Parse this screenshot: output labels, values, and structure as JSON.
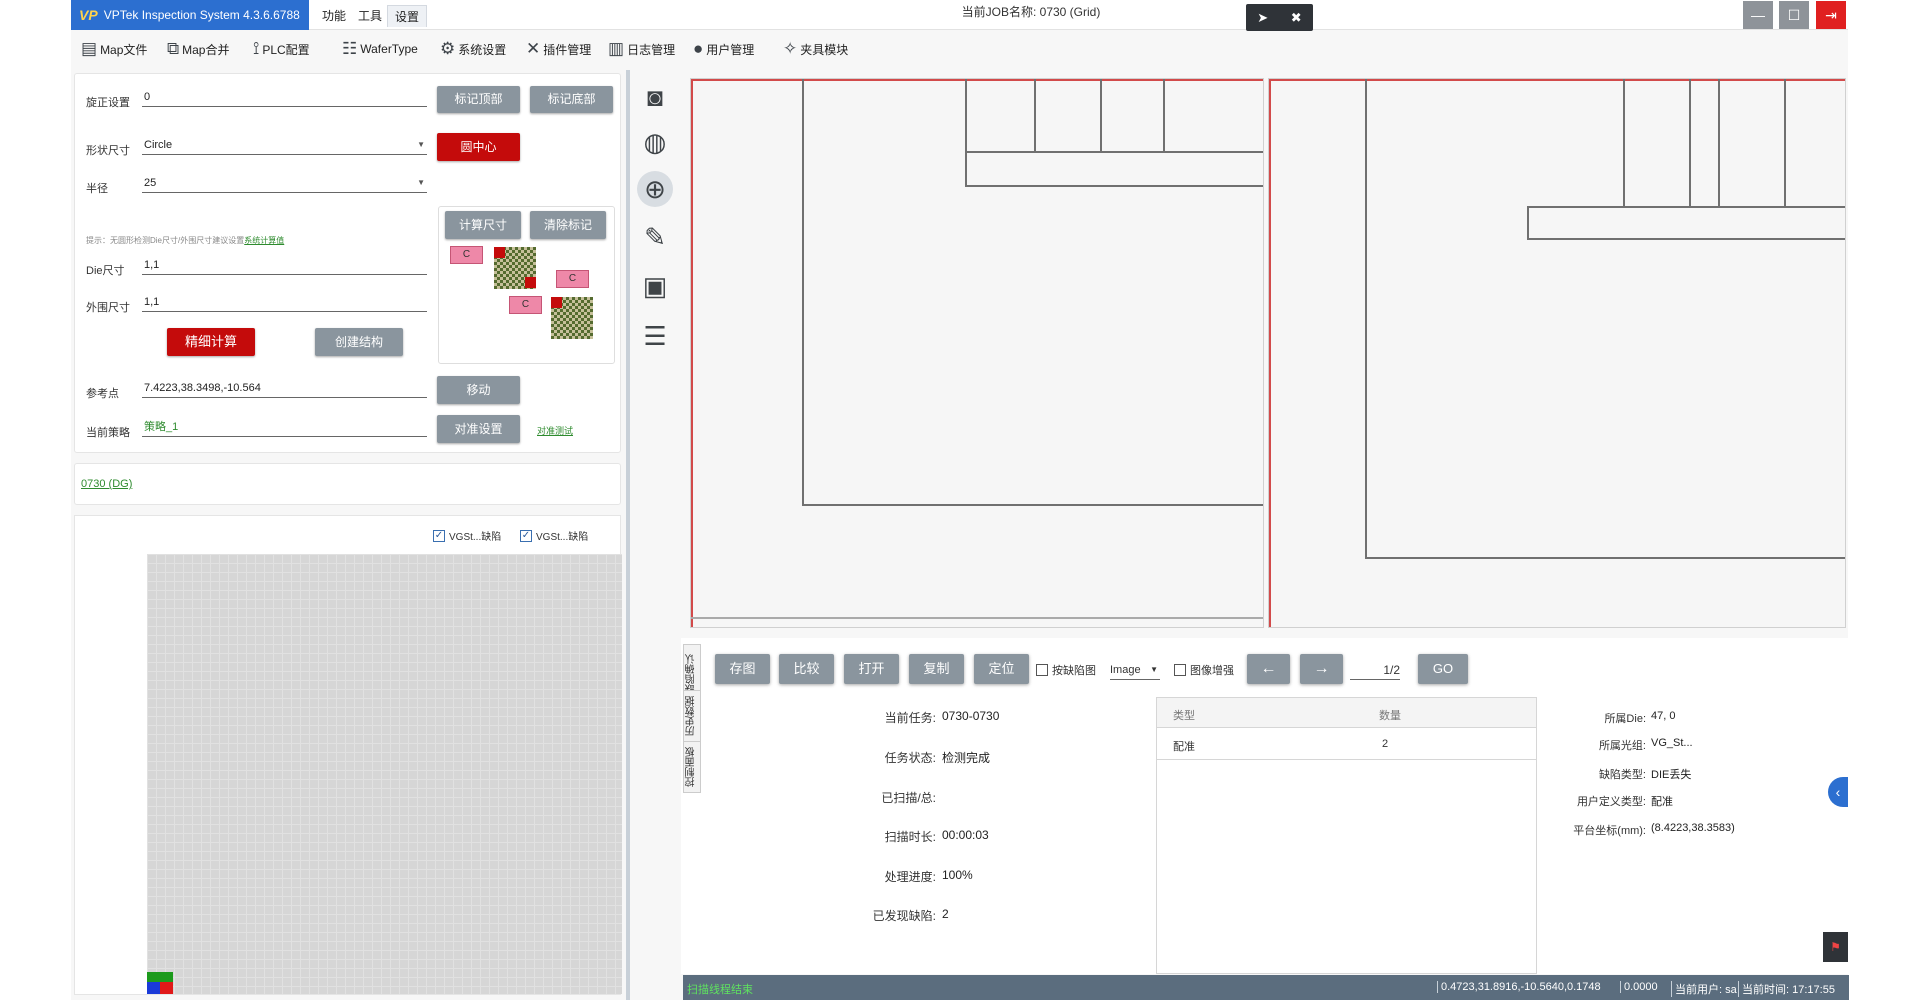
{
  "window": {
    "brand_logo": "VP",
    "app_title": "VPTek Inspection System 4.3.6.6788",
    "menus": [
      "功能",
      "工具",
      "设置"
    ],
    "active_menu": "设置",
    "job_title": "当前JOB名称: 0730 (Grid)"
  },
  "float_toolbar": {
    "cursor_icon": "cursor-icon",
    "close_icon": "close-circle-icon"
  },
  "window_controls": {
    "minimize": "—",
    "maximize": "☐",
    "exit": "⇥"
  },
  "toolbar": [
    {
      "label": "Map文件",
      "icon": "map-file-icon"
    },
    {
      "label": "Map合并",
      "icon": "map-merge-icon"
    },
    {
      "label": "PLC配置",
      "icon": "plc-icon"
    },
    {
      "label": "WaferType",
      "icon": "wafertype-icon"
    },
    {
      "label": "系统设置",
      "icon": "gear-icon"
    },
    {
      "label": "插件管理",
      "icon": "tools-icon"
    },
    {
      "label": "日志管理",
      "icon": "log-icon"
    },
    {
      "label": "用户管理",
      "icon": "user-icon"
    },
    {
      "label": "夹具模块",
      "icon": "fixture-icon"
    }
  ],
  "settings": {
    "rotation_label": "旋正设置",
    "rotation_value": "0",
    "mark_top_button": "标记顶部",
    "mark_bottom_button": "标记底部",
    "shape_label": "形状尺寸",
    "shape_value": "Circle",
    "circle_center_button": "圆中心",
    "radius_label": "半径",
    "radius_value": "25",
    "hint_text": "提示：无圆形检测Die尺寸/外围尺寸建议设置",
    "hint_link": "系统计算值",
    "die_size_label": "Die尺寸",
    "die_size_value": "1,1",
    "outer_size_label": "外围尺寸",
    "outer_size_value": "1,1",
    "fine_calc_button": "精细计算",
    "create_structure_button": "创建结构",
    "calc_size_button": "计算尺寸",
    "clear_mark_button": "清除标记",
    "diagram_labels": [
      "C",
      "C",
      "C"
    ],
    "ref_point_label": "参考点",
    "ref_point_value": "7.4223,38.3498,-10.564",
    "move_button": "移动",
    "strategy_label": "当前策略",
    "strategy_value": "策略_1",
    "align_settings_button": "对准设置",
    "align_test_link": "对准测试"
  },
  "job_link": "0730 (DG)",
  "map_legend": [
    {
      "label": "VGSt...缺陷",
      "checked": true
    },
    {
      "label": "VGSt...缺陷",
      "checked": true
    }
  ],
  "side_icons": [
    "camera-icon",
    "grid-sphere-icon",
    "wafer-focus-icon",
    "ruler-icon",
    "chart-image-icon",
    "checklist-icon"
  ],
  "vertical_tabs": [
    "缺陷确认",
    "历史数据",
    "控制面板"
  ],
  "actions": {
    "save_image": "存图",
    "compare": "比较",
    "open": "打开",
    "copy": "复制",
    "locate": "定位",
    "by_defect_label": "按缺陷图",
    "image_select": "Image",
    "enhance_label": "图像增强",
    "prev": "←",
    "next": "→",
    "page": "1/2",
    "go": "GO"
  },
  "task_info": {
    "task_label": "当前任务:",
    "task_value": "0730-0730",
    "state_label": "任务状态:",
    "state_value": "检测完成",
    "scanned_label": "已扫描/总:",
    "scanned_value": "",
    "duration_label": "扫描时长:",
    "duration_value": "00:00:03",
    "progress_label": "处理进度:",
    "progress_value": "100%",
    "defects_label": "已发现缺陷:",
    "defects_value": "2"
  },
  "defect_table": {
    "headers": [
      "类型",
      "数量"
    ],
    "rows": [
      [
        "配准",
        "2"
      ]
    ]
  },
  "defect_detail": {
    "die_label": "所属Die:",
    "die_value": "47, 0",
    "light_label": "所属光组:",
    "light_value": "VG_St...",
    "type_label": "缺陷类型:",
    "type_value": "DIE丢失",
    "user_type_label": "用户定义类型:",
    "user_type_value": "配准",
    "coord_label": "平台坐标(mm):",
    "coord_value": "(8.4223,38.3583)"
  },
  "status": {
    "message": "扫描线程结束",
    "coords": "0.4723,31.8916,-10.5640,0.1748",
    "value": "0.0000",
    "user": "当前用户: sa",
    "time": "当前时间: 17:17:55"
  },
  "colors": {
    "brand_blue": "#2c6fd0",
    "button_gray": "#8a959e",
    "button_red": "#c40b0b",
    "status_bar": "#5b6d7e",
    "link_green": "#2e8b2e"
  }
}
